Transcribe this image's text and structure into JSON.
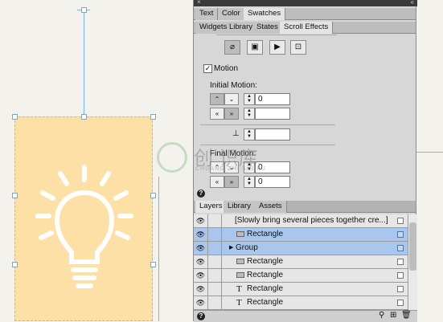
{
  "canvas": {
    "card_color": "#fde0a6",
    "icon": "lightbulb-icon"
  },
  "panel": {
    "top_tabs": [
      "Text",
      "Color",
      "Swatches"
    ],
    "sub_tabs": [
      "Widgets Library",
      "States",
      "Scroll Effects"
    ],
    "active_sub_tab": "Scroll Effects",
    "tools": [
      "eraser-icon",
      "opacity-icon",
      "slideshow-icon",
      "resize-icon"
    ],
    "motion": {
      "checked": true,
      "label": "Motion"
    },
    "initial_motion": {
      "label": "Initial Motion:",
      "vertical_value": "0",
      "horizontal_value": ""
    },
    "key_position_value": "",
    "final_motion": {
      "label": "Final Motion:",
      "vertical_value": "0",
      "horizontal_value": "0"
    },
    "help_label": "?"
  },
  "layers": {
    "tabs": [
      "Layers",
      "Library",
      "Assets"
    ],
    "rows": [
      {
        "label": "[Slowly bring several pieces together cre...]",
        "type": "group",
        "selected": false
      },
      {
        "label": "Rectangle",
        "type": "rect",
        "selected": true
      },
      {
        "label": "Group",
        "type": "group",
        "selected": true
      },
      {
        "label": "Rectangle",
        "type": "rect",
        "selected": false
      },
      {
        "label": "Rectangle",
        "type": "rect",
        "selected": false
      },
      {
        "label": "Rectangle",
        "type": "text",
        "selected": false
      },
      {
        "label": "Rectangle",
        "type": "text",
        "selected": false
      }
    ],
    "help_label": "?"
  },
  "watermark": {
    "text": "创 识库",
    "subtext": "CHUANG ZHI SHI KU"
  }
}
